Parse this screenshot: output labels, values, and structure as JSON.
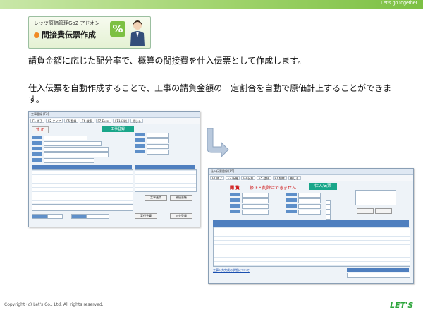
{
  "header": {
    "tagline": "Let's go together"
  },
  "badge": {
    "subtitle": "レッツ原価管理Go2 アドオン",
    "title": "間接費伝票作成",
    "icon": "percent-icon"
  },
  "body": {
    "paragraph1": "請負金額に応じた配分率で、概算の間接費を仕入伝票として作成します。",
    "paragraph2": "仕入伝票を自動作成することで、工事の請負金額の一定割合を自動で原価計上することができます。"
  },
  "window1": {
    "title": "工事登録 [F2]",
    "toolbar": [
      "F1 終了",
      "F2 クリア",
      "F5 登録",
      "F6 検索",
      "F7 Excel",
      "F11 印刷",
      "閉じる"
    ],
    "mode": "修 正",
    "banner": "工事登録",
    "buttons": [
      "工事進捗",
      "原価台帳",
      "実行予算",
      "入金登録"
    ]
  },
  "window2": {
    "title": "仕入伝票登録 [F5]",
    "toolbar": [
      "F1 終了",
      "F2 新規",
      "F3 伝票",
      "F5 登録",
      "F7 削除",
      "閉じる"
    ],
    "mode": "閲 覧",
    "warning": "修正・削除はできません",
    "banner": "仕入伝票",
    "footer_link": "工事入力完成の状態について"
  },
  "footer": {
    "copyright": "Copyright (c) Let's Co., Ltd. All rights reserved.",
    "logo": "LET'S"
  }
}
